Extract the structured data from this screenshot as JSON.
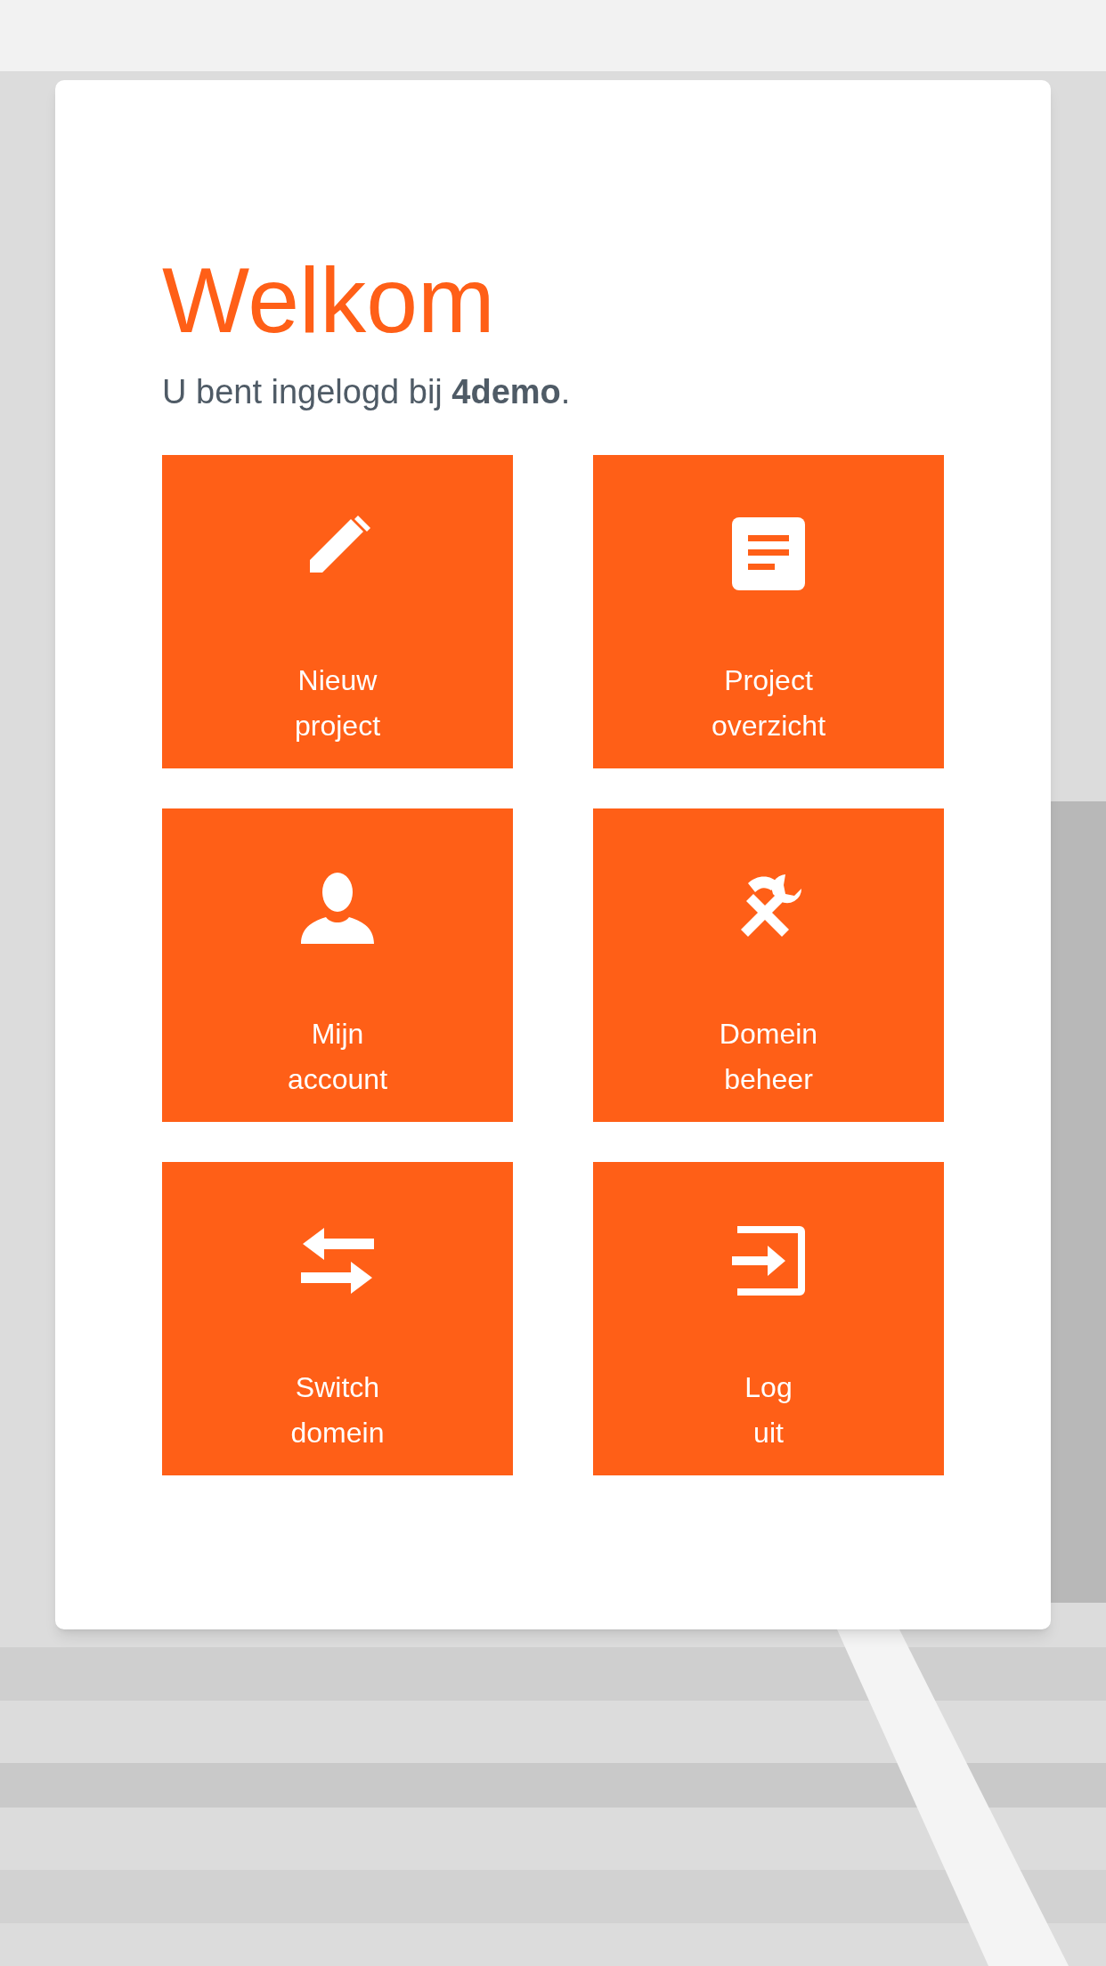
{
  "title": "Welkom",
  "subtitle": "U bent ingelogd bij **4demo**.",
  "tiles": [
    {
      "lines": [
        "Nieuw",
        "project"
      ]
    },
    {
      "lines": [
        "Project",
        "overzicht"
      ]
    },
    {
      "lines": [
        "Mijn",
        "account"
      ]
    },
    {
      "lines": [
        "Domein",
        "beheer"
      ]
    },
    {
      "lines": [
        "Switch",
        "domein"
      ]
    },
    {
      "lines": [
        "Log",
        "uit"
      ]
    }
  ]
}
